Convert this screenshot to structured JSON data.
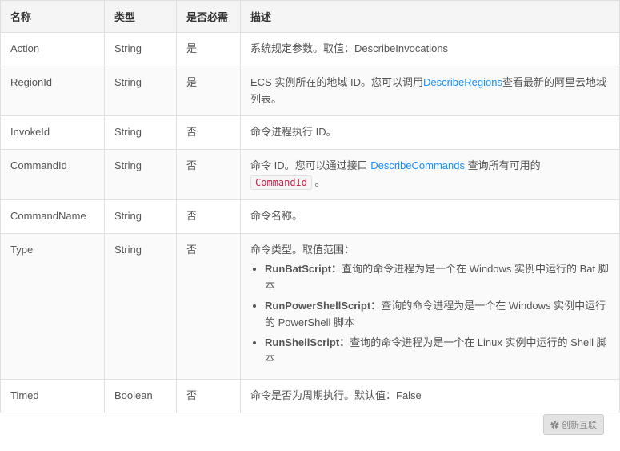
{
  "table": {
    "headers": [
      "名称",
      "类型",
      "是否必需",
      "描述"
    ],
    "rows": [
      {
        "name": "Action",
        "type": "String",
        "required": "是",
        "desc_text": "系统规定参数。取值：DescribeInvocations"
      },
      {
        "name": "RegionId",
        "type": "String",
        "required": "是",
        "desc_text": "ECS 实例所在的地域 ID。您可以调用",
        "desc_link": "DescribeRegions",
        "desc_link_url": "#",
        "desc_after": "查看最新的阿里云地域列表。"
      },
      {
        "name": "InvokeId",
        "type": "String",
        "required": "否",
        "desc_text": "命令进程执行 ID。"
      },
      {
        "name": "CommandId",
        "type": "String",
        "required": "否",
        "desc_text": "命令 ID。您可以通过接口 ",
        "desc_link": "DescribeCommands",
        "desc_link_url": "#",
        "desc_after": " 查询所有可用的",
        "desc_code": "CommandId",
        "desc_final": " 。"
      },
      {
        "name": "CommandName",
        "type": "String",
        "required": "否",
        "desc_text": "命令名称。"
      },
      {
        "name": "Type",
        "type": "String",
        "required": "否",
        "desc_intro": "命令类型。取值范围：",
        "desc_bullets": [
          "RunBatScript：查询的命令进程为是一个在 Windows 实例中运行的 Bat 脚本",
          "RunPowerShellScript：查询的命令进程为是一个在 Windows 实例中运行的 PowerShell 脚本",
          "RunShellScript：查询的命令进程为是一个在 Linux 实例中运行的 Shell 脚本"
        ]
      },
      {
        "name": "Timed",
        "type": "Boolean",
        "required": "否",
        "desc_text": "命令是否为周期执行。默认值：False"
      }
    ]
  },
  "watermark": {
    "label": "创新互联"
  }
}
